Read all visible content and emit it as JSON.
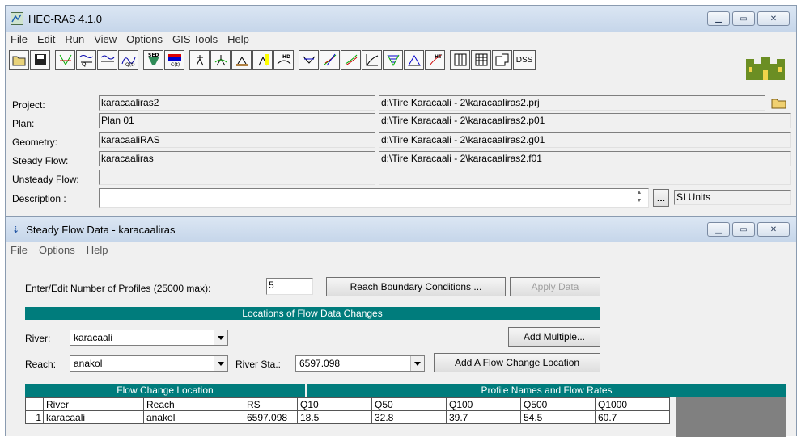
{
  "main_window": {
    "title": "HEC-RAS 4.1.0",
    "menu": [
      "File",
      "Edit",
      "Run",
      "View",
      "Options",
      "GIS Tools",
      "Help"
    ],
    "toolbar_icons": [
      "open-icon",
      "save-icon",
      "geometry-icon",
      "steady-flow-icon",
      "unsteady-flow-icon",
      "quasi-unsteady-icon",
      "sediment-icon",
      "water-quality-icon",
      "steady-analysis-icon",
      "unsteady-analysis-icon",
      "sediment-analysis-icon",
      "water-quality-analysis-icon",
      "hydraulic-design-icon",
      "cross-section-plot-icon",
      "profile-plot-icon",
      "general-profile-plot-icon",
      "rating-curve-icon",
      "xyz-plot-icon",
      "stage-hydrograph-icon",
      "hydraulic-table-icon",
      "detailed-output-icon",
      "summary-table-icon",
      "summary-errors-icon",
      "dss-icon"
    ],
    "dss_label": "DSS",
    "project": {
      "label": "Project:",
      "name": "karacaaliras2",
      "path": "d:\\Tire Karacaali - 2\\karacaaliras2.prj"
    },
    "plan": {
      "label": "Plan:",
      "name": "Plan 01",
      "path": "d:\\Tire Karacaali - 2\\karacaaliras2.p01"
    },
    "geometry": {
      "label": "Geometry:",
      "name": "karacaaliRAS",
      "path": "d:\\Tire Karacaali - 2\\karacaaliras2.g01"
    },
    "steady_flow": {
      "label": "Steady Flow:",
      "name": "karacaaliras",
      "path": "d:\\Tire Karacaali - 2\\karacaaliras2.f01"
    },
    "unsteady_flow": {
      "label": "Unsteady Flow:",
      "name": "",
      "path": ""
    },
    "description": {
      "label": "Description :",
      "value": ""
    },
    "ellipsis": "...",
    "units": "SI Units"
  },
  "steady_flow_window": {
    "title": "Steady Flow Data - karacaaliras",
    "menu": [
      "File",
      "Options",
      "Help"
    ],
    "profiles_label": "Enter/Edit Number of Profiles (25000 max):",
    "profiles_value": "5",
    "reach_bc_button": "Reach Boundary Conditions ...",
    "apply_button": "Apply Data",
    "locations_header": "Locations of Flow Data Changes",
    "river_label": "River:",
    "river_value": "karacaali",
    "add_multiple_button": "Add Multiple...",
    "reach_label": "Reach:",
    "reach_value": "anakol",
    "river_sta_label": "River Sta.:",
    "river_sta_value": "6597.098",
    "add_location_button": "Add A Flow Change Location",
    "table": {
      "left_header": "Flow Change Location",
      "right_header": "Profile Names and Flow Rates",
      "columns": [
        "River",
        "Reach",
        "RS",
        "Q10",
        "Q50",
        "Q100",
        "Q500",
        "Q1000"
      ],
      "rows": [
        {
          "index": "1",
          "cells": [
            "karacaali",
            "anakol",
            "6597.098",
            "18.5",
            "32.8",
            "39.7",
            "54.5",
            "60.7"
          ]
        }
      ]
    }
  },
  "colors": {
    "teal": "#007c7c",
    "titlebar": "#c6d6ea"
  }
}
